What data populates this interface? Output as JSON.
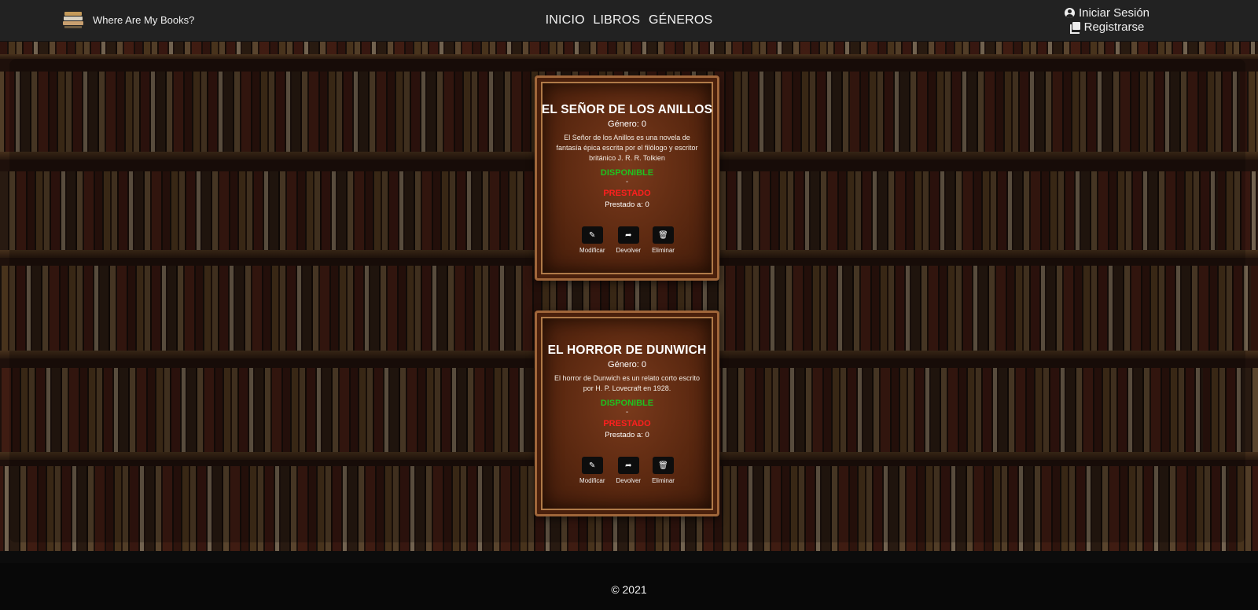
{
  "header": {
    "brand_name": "Where Are My Books?",
    "nav_links": [
      "INICIO",
      "LIBROS",
      "GÉNEROS"
    ],
    "login_label": "Iniciar Sesión",
    "register_label": "Registrarse"
  },
  "books": [
    {
      "title": "EL SEÑOR DE LOS ANILLOS",
      "genre": "Género: 0",
      "description": "El Señor de los Anillos es una novela de fantasía épica escrita por el filólogo y escritor británico J. R. R. Tolkien",
      "status_available": "DISPONIBLE",
      "separator": "-",
      "status_lent": "PRESTADO",
      "lent_to": "Prestado a: 0",
      "actions": [
        "Modificar",
        "Devolver",
        "Eliminar"
      ]
    },
    {
      "title": "EL HORROR DE DUNWICH",
      "genre": "Género: 0",
      "description": "El horror de Dunwich es un relato corto escrito por H. P. Lovecraft en 1928.",
      "status_available": "DISPONIBLE",
      "separator": "-",
      "status_lent": "PRESTADO",
      "lent_to": "Prestado a: 0",
      "actions": [
        "Modificar",
        "Devolver",
        "Eliminar"
      ]
    }
  ],
  "footer": {
    "copyright": "© 2021"
  },
  "colors": {
    "available": "#1fc21f",
    "lent": "#ff1f1f",
    "navbar": "#222222"
  },
  "icons": [
    "books-logo-icon",
    "user-circle-icon",
    "book-register-icon",
    "pencil-icon",
    "share-arrow-icon",
    "trash-icon"
  ]
}
